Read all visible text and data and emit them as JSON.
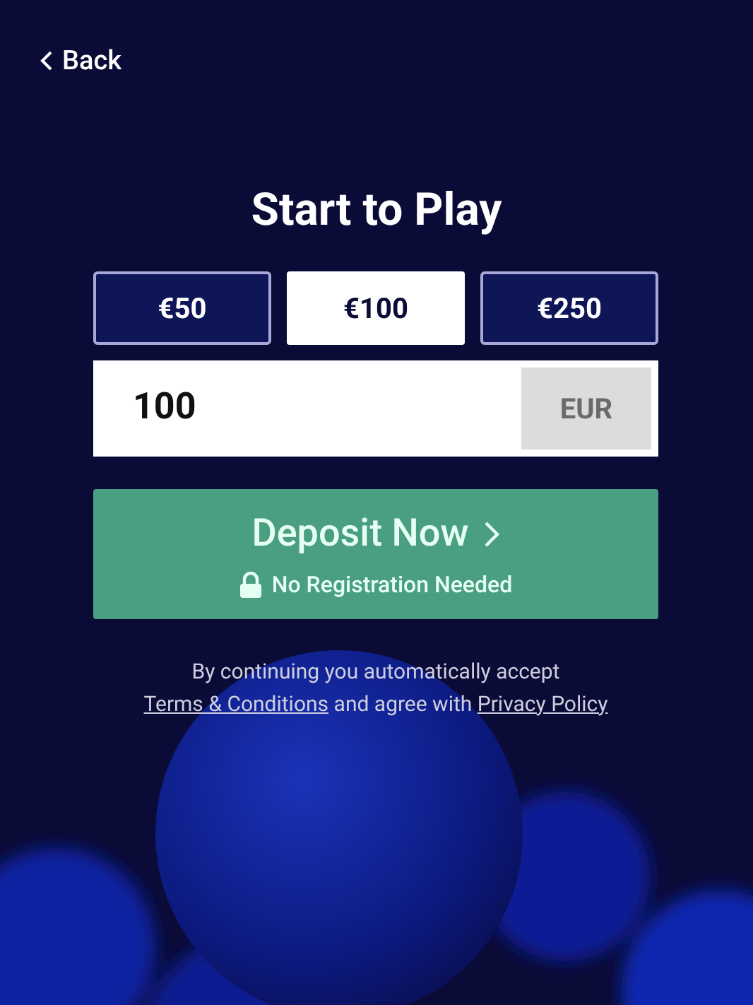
{
  "back": {
    "label": "Back"
  },
  "title": "Start to Play",
  "amounts": [
    {
      "label": "€50",
      "selected": false
    },
    {
      "label": "€100",
      "selected": true
    },
    {
      "label": "€250",
      "selected": false
    }
  ],
  "amount_field": {
    "value": "100",
    "currency": "EUR"
  },
  "deposit_button": {
    "label": "Deposit Now",
    "sublabel": "No Registration Needed"
  },
  "legal": {
    "before": "By continuing you automatically accept",
    "terms_link": "Terms & Conditions",
    "middle": "and agree with",
    "privacy_link": "Privacy Policy"
  }
}
